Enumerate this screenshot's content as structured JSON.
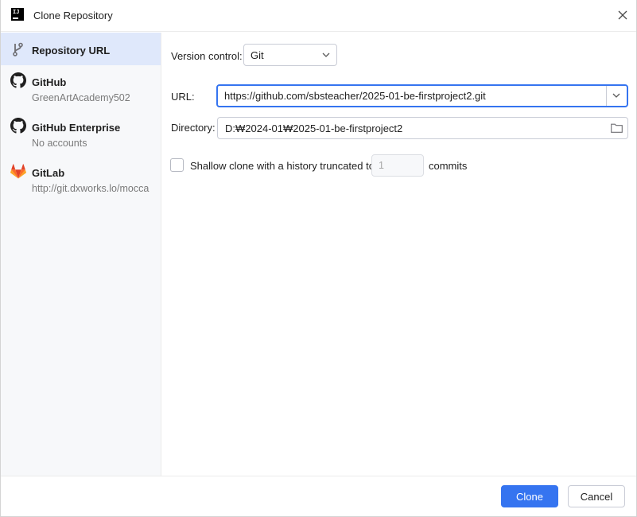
{
  "window": {
    "title": "Clone Repository",
    "app_logo_text": "IJ"
  },
  "sidebar": {
    "items": [
      {
        "label": "Repository URL",
        "sub": "",
        "icon": "git-branch-icon",
        "selected": true
      },
      {
        "label": "GitHub",
        "sub": "GreenArtAcademy502",
        "icon": "github-icon",
        "selected": false
      },
      {
        "label": "GitHub Enterprise",
        "sub": "No accounts",
        "icon": "github-icon",
        "selected": false
      },
      {
        "label": "GitLab",
        "sub": "http://git.dxworks.lo/mocca",
        "icon": "gitlab-icon",
        "selected": false
      }
    ]
  },
  "form": {
    "version_control_label": "Version control:",
    "version_control_value": "Git",
    "url_label": "URL:",
    "url_value": "https://github.com/sbsteacher/2025-01-be-firstproject2.git",
    "directory_label": "Directory:",
    "directory_value": "D:₩2024-01₩2025-01-be-firstproject2",
    "shallow_label": "Shallow clone with a history truncated to",
    "shallow_checked": false,
    "depth_value": "1",
    "commits_label": "commits"
  },
  "footer": {
    "clone_label": "Clone",
    "cancel_label": "Cancel"
  },
  "colors": {
    "accent": "#3574f0",
    "selection": "#dfe8fb",
    "sidebar_bg": "#f7f8fa",
    "gitlab_orange": "#e24329"
  }
}
